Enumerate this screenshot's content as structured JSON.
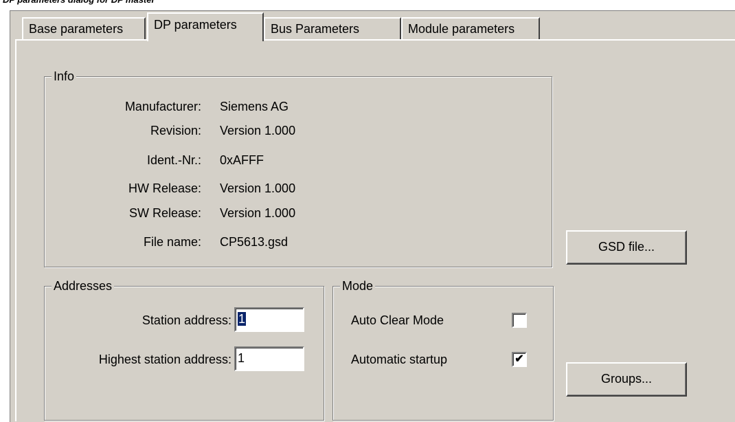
{
  "caption": "DP parameters dialog for DP master",
  "tabs": [
    {
      "label": "Base parameters"
    },
    {
      "label": "DP parameters"
    },
    {
      "label": "Bus Parameters"
    },
    {
      "label": "Module parameters"
    }
  ],
  "info": {
    "legend": "Info",
    "rows": [
      {
        "label": "Manufacturer:",
        "value": "Siemens AG"
      },
      {
        "label": "Revision:",
        "value": "Version 1.000"
      },
      {
        "label": "Ident.-Nr.:",
        "value": "0xAFFF"
      },
      {
        "label": "HW Release:",
        "value": "Version 1.000"
      },
      {
        "label": "SW Release:",
        "value": "Version 1.000"
      },
      {
        "label": "File name:",
        "value": "CP5613.gsd"
      }
    ]
  },
  "addresses": {
    "legend": "Addresses",
    "station_label": "Station address:",
    "station_value": "1",
    "highest_label": "Highest station address:",
    "highest_value": "1"
  },
  "mode": {
    "legend": "Mode",
    "auto_clear_label": "Auto Clear Mode",
    "auto_clear_checked": false,
    "auto_startup_label": "Automatic startup",
    "auto_startup_checked": true
  },
  "buttons": {
    "gsd": "GSD file...",
    "groups": "Groups..."
  },
  "colors": {
    "dialog_bg": "#d4d0c8",
    "selection": "#0a246a"
  }
}
